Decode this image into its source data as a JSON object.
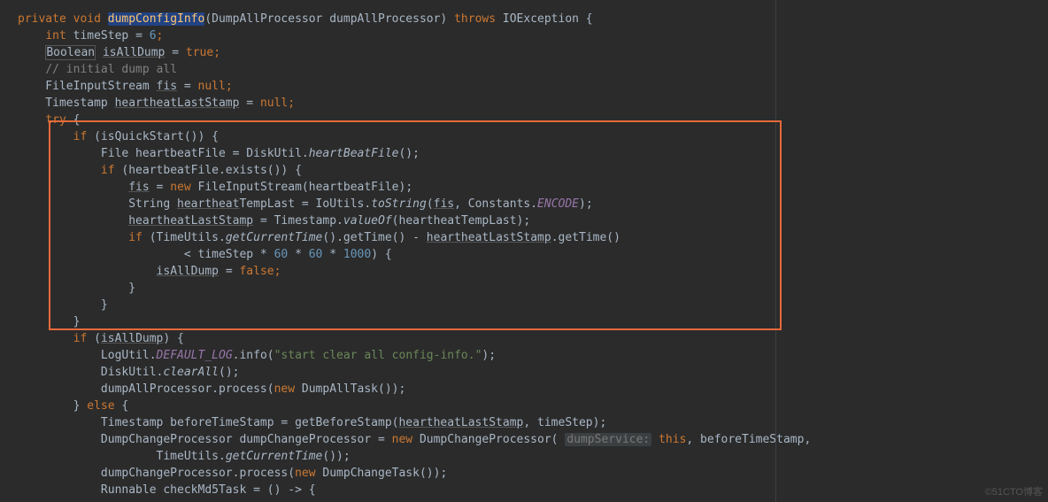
{
  "code": {
    "l1": {
      "a": "private void ",
      "b": "dumpConfigInfo",
      "c": "(DumpAllProcessor dumpAllProcessor) ",
      "d": "throws ",
      "e": "IOException {"
    },
    "l2": {
      "a": "    ",
      "b": "int ",
      "c": "timeStep = ",
      "d": "6",
      "e": ";"
    },
    "l3": {
      "a": "    ",
      "b": "Boolean",
      "c": " ",
      "d": "isAllDump",
      "e": " = ",
      "f": "true",
      "g": ";"
    },
    "l4": {
      "a": "    ",
      "b": "// initial dump all"
    },
    "l5": {
      "a": "    FileInputStream ",
      "b": "fis",
      "c": " = ",
      "d": "null",
      "e": ";"
    },
    "l6": {
      "a": "    Timestamp ",
      "b": "heartheatLastStamp",
      "c": " = ",
      "d": "null",
      "e": ";"
    },
    "l7": {
      "a": "    ",
      "b": "try ",
      "c": "{"
    },
    "l8": {
      "a": "        ",
      "b": "if ",
      "c": "(isQuickStart()) {"
    },
    "l9": {
      "a": "            File heartbeatFile = DiskUtil.",
      "b": "heartBeatFile",
      "c": "();"
    },
    "l10": {
      "a": "            ",
      "b": "if ",
      "c": "(heartbeatFile.exists()) {"
    },
    "l11": {
      "a": "                ",
      "b": "fis",
      "c": " = ",
      "d": "new ",
      "e": "FileInputStream(heartbeatFile);"
    },
    "l12": {
      "a": "                String ",
      "b": "heartheat",
      "c": "TempLast = IoUtils.",
      "d": "toString",
      "e": "(",
      "f": "fis",
      "g": ", Constants.",
      "h": "ENCODE",
      "i": ");"
    },
    "l13": {
      "a": "                ",
      "b": "heartheatLastStamp",
      "c": " = Timestamp.",
      "d": "valueOf",
      "e": "(heartheatTempLast);"
    },
    "l14": {
      "a": "                ",
      "b": "if ",
      "c": "(TimeUtils.",
      "d": "getCurrentTime",
      "e": "().getTime() - ",
      "f": "heartheatLastStamp",
      "g": ".getTime()"
    },
    "l15": {
      "a": "                        < timeStep * ",
      "b": "60",
      "c": " * ",
      "d": "60",
      "e": " * ",
      "f": "1000",
      "g": ") {"
    },
    "l16": {
      "a": "                    ",
      "b": "isAllDump",
      "c": " = ",
      "d": "false",
      "e": ";"
    },
    "l17": {
      "a": "                }"
    },
    "l18": {
      "a": "            }"
    },
    "l19": {
      "a": "        }"
    },
    "l20": {
      "a": "        ",
      "b": "if ",
      "c": "(",
      "d": "isAllDump",
      "e": ") {"
    },
    "l21": {
      "a": "            LogUtil.",
      "b": "DEFAULT_LOG",
      "c": ".info(",
      "d": "\"start clear all config-info.\"",
      "e": ");"
    },
    "l22": {
      "a": "            DiskUtil.",
      "b": "clearAll",
      "c": "();"
    },
    "l23": {
      "a": "            dumpAllProcessor.process(",
      "b": "new ",
      "c": "DumpAllTask());"
    },
    "l24": {
      "a": "        } ",
      "b": "else ",
      "c": "{"
    },
    "l25": {
      "a": "            Timestamp beforeTimeStamp = getBeforeStamp(",
      "b": "heartheatLastStamp",
      "c": ", timeStep);"
    },
    "l26": {
      "a": "            DumpChangeProcessor dumpChangeProcessor = ",
      "b": "new ",
      "c": "DumpChangeProcessor( ",
      "d": "dumpService:",
      "e": " ",
      "f": "this",
      "g": ", beforeTimeStamp,"
    },
    "l27": {
      "a": "                    TimeUtils.",
      "b": "getCurrentTime",
      "c": "());"
    },
    "l28": {
      "a": "            dumpChangeProcessor.process(",
      "b": "new ",
      "c": "DumpChangeTask());"
    },
    "l29": {
      "a": "            Runnable checkMd5Task = () -> {"
    }
  },
  "watermark": "©51CTO博客"
}
